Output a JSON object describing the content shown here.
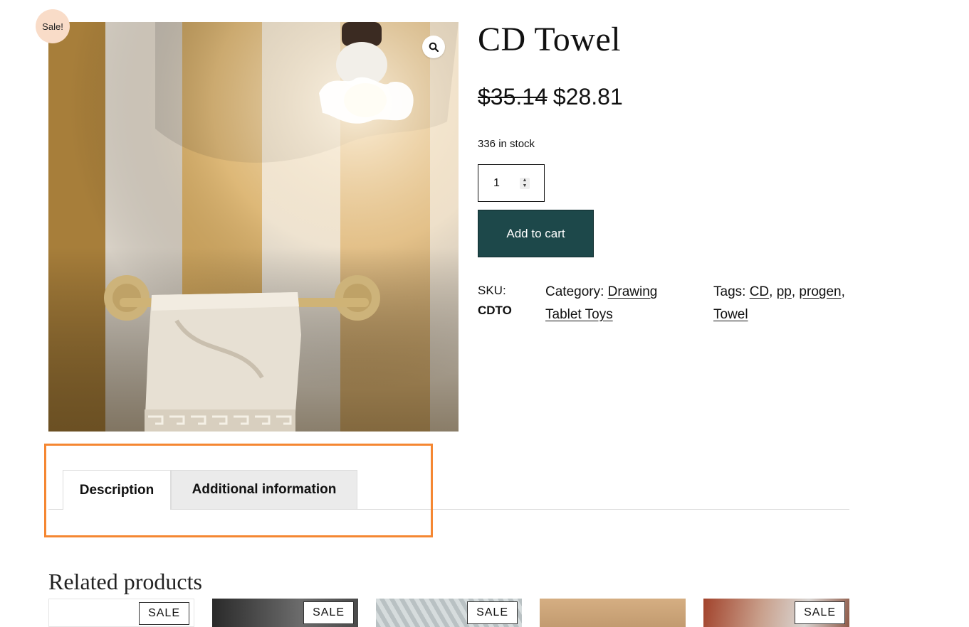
{
  "header": {
    "cut_text": ""
  },
  "gallery": {
    "sale_badge": "Sale!",
    "zoom_icon": "magnifier-icon"
  },
  "product": {
    "title": "CD Towel",
    "price_old": "$35.14",
    "price_new": "$28.81",
    "stock": "336 in stock",
    "quantity": "1",
    "add_to_cart": "Add to cart",
    "sku_label": "SKU:",
    "sku_value": "CDTO",
    "category_label": "Category:",
    "category_link": "Drawing Tablet Toys",
    "tags_label": "Tags:",
    "tags": [
      "CD",
      "pp",
      "progen",
      "Towel"
    ],
    "tag_separator": ","
  },
  "tabs": [
    {
      "label": "Description"
    },
    {
      "label": "Additional information"
    }
  ],
  "related": {
    "title": "Related products",
    "sale_label": "SALE"
  },
  "colors": {
    "accent": "#1d484a",
    "sale_badge_bg": "#f9dcc8",
    "highlight": "#f58732"
  }
}
